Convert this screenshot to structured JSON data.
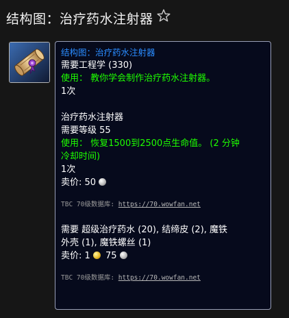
{
  "header": {
    "title": "结构图：治疗药水注射器"
  },
  "icon": {
    "name": "schematic-scroll-icon"
  },
  "tooltip": {
    "item_name": "结构图：治疗药水注射器",
    "req_skill": "需要工程学 (330)",
    "use1": "使用： 教你学会制作治疗药水注射器。",
    "charges1": "1次",
    "created_name": "治疗药水注射器",
    "req_level": "需要等级 55",
    "use2_line1": "使用： 恢复1500到2500点生命值。 (2 分钟",
    "use2_line2": "冷却时间)",
    "charges2": "1次",
    "sell1_label": "卖价:",
    "sell1_silver": "50",
    "db_label_1": "TBC 70级数据库:",
    "db_link_1": "https://70.wowfan.net",
    "reagents_line1": "需要 超级治疗药水 (20), 结缔皮 (2), 魔铁",
    "reagents_line2": "外壳 (1), 魔铁螺丝 (1)",
    "sell2_label": "卖价:",
    "sell2_gold": "1",
    "sell2_silver": "75",
    "db_label_2": "TBC 70级数据库:",
    "db_link_2": "https://70.wowfan.net"
  },
  "colors": {
    "item_name": "#2a8cff",
    "use_text": "#1eff00",
    "tooltip_bg": "#060a1c",
    "page_bg": "#161616"
  }
}
